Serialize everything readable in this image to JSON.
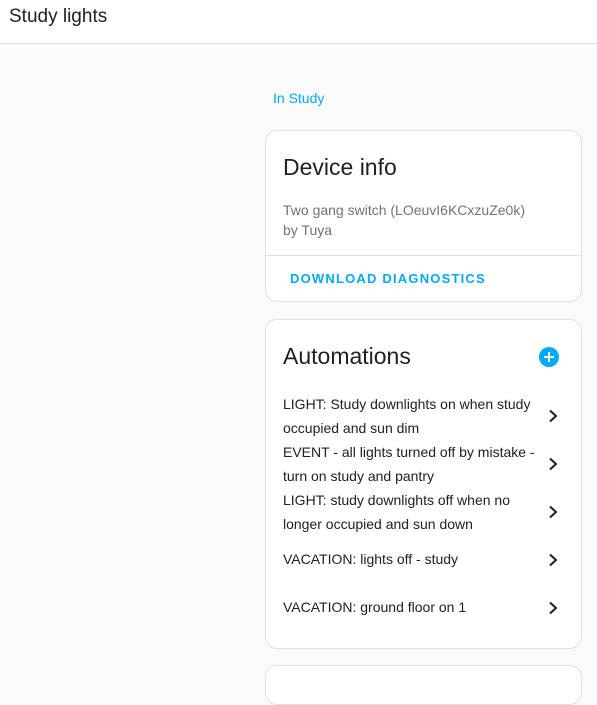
{
  "header": {
    "title": "Study lights"
  },
  "area": {
    "link_label": "In Study"
  },
  "device_info": {
    "title": "Device info",
    "description_line1": "Two gang switch (LOeuvI6KCxzuZe0k)",
    "description_line2": "by Tuya",
    "download_label": "DOWNLOAD DIAGNOSTICS"
  },
  "automations": {
    "title": "Automations",
    "add_icon": "plus-circle-icon",
    "items": [
      {
        "label": "LIGHT: Study downlights on when study occupied and sun dim"
      },
      {
        "label": "EVENT - all lights turned off by mistake - turn on study and pantry"
      },
      {
        "label": "LIGHT: study downlights off when no longer occupied and sun down"
      },
      {
        "label": "VACATION: lights off - study"
      },
      {
        "label": "VACATION: ground floor on 1"
      }
    ]
  },
  "colors": {
    "accent": "#03a9f4",
    "text": "#212121",
    "secondary_text": "#727272"
  }
}
